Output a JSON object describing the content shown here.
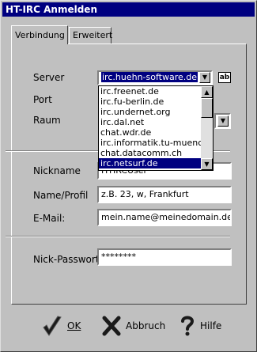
{
  "window": {
    "title": "HT-IRC Anmelden"
  },
  "tabs": [
    {
      "label": "Verbindung",
      "active": true
    },
    {
      "label": "Erweitert",
      "active": false
    }
  ],
  "connection": {
    "server_label": "Server",
    "server_value": "irc.huehn-software.de",
    "port_label": "Port",
    "room_label": "Raum",
    "ab_button": "ab",
    "server_options": [
      "irc.freenet.de",
      "irc.fu-berlin.de",
      "irc.undernet.org",
      "irc.dal.net",
      "chat.wdr.de",
      "irc.informatik.tu-muenchen.",
      "chat.datacomm.ch",
      "irc.netsurf.de"
    ],
    "selected_option": "irc.netsurf.de"
  },
  "profile": {
    "nickname_label": "Nickname",
    "nickname_value": "HTIRCUser",
    "name_label": "Name/Profil",
    "name_value": "z.B. 23, w, Frankfurt",
    "email_label": "E-Mail:",
    "email_value": "mein.name@meinedomain.de",
    "password_label": "Nick-Passwort",
    "password_value": "********"
  },
  "buttons": {
    "ok": "OK",
    "abbruch": "Abbruch",
    "hilfe": "Hilfe"
  },
  "colors": {
    "titlebar": "#000080",
    "selection": "#000080",
    "face": "#c0c0c0"
  }
}
